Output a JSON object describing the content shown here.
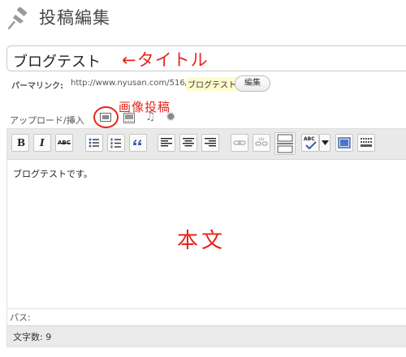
{
  "header": {
    "title": "投稿編集",
    "icon": "pushpin-icon"
  },
  "title_field": {
    "value": "ブログテスト",
    "annotation": "←タイトル"
  },
  "permalink": {
    "label": "パーマリンク:",
    "url": "http://www.nyusan.com/516/",
    "slug": "ブログテスト",
    "edit_label": "編集"
  },
  "upload": {
    "label": "アップロード/挿入",
    "annotation": "画像投稿",
    "icons": [
      "image-icon",
      "video-icon",
      "audio-icon",
      "media-icon"
    ]
  },
  "toolbar": {
    "bold": "B",
    "italic": "I",
    "strike": "ABC",
    "spell": "ABC",
    "buttons": [
      "bold",
      "italic",
      "strikethrough",
      "bullet-list",
      "numbered-list",
      "blockquote",
      "align-left",
      "align-center",
      "align-right",
      "link",
      "unlink",
      "more",
      "spellcheck",
      "fullscreen",
      "kitchen-sink"
    ]
  },
  "editor": {
    "content": "ブログテストです。",
    "annotation": "本文"
  },
  "status": {
    "path_label": "パス:",
    "word_count": "文字数: 9"
  },
  "colors": {
    "annotation": "#e8231c",
    "toolbar": "#e9e9e9",
    "slug_highlight": "#fffbcc"
  }
}
